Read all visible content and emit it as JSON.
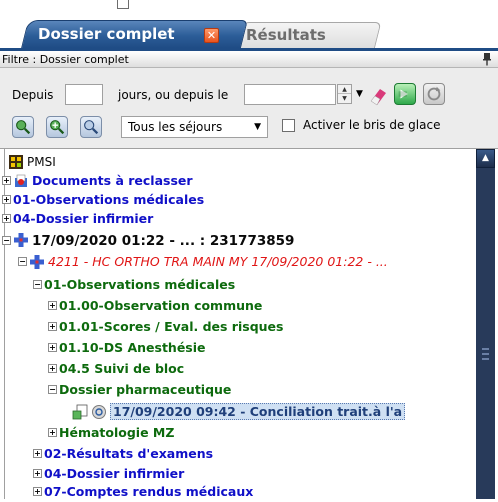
{
  "tabs": {
    "active": {
      "label": "Dossier complet"
    },
    "inactive": {
      "label": "Résultats"
    }
  },
  "filter": {
    "title": "Filtre : Dossier complet"
  },
  "toolbar": {
    "depuis_label": "Depuis",
    "jours_label": "jours, ou depuis le",
    "days_value": "",
    "date_value": "",
    "sejours_select": "Tous les séjours",
    "bris_label": "Activer le bris de glace"
  },
  "tree": {
    "pmsi": "PMSI",
    "documents": "Documents à reclasser",
    "obs_medicales_root": "01-Observations médicales",
    "dossier_infirmier_root": "04-Dossier infirmier",
    "sejour": "17/09/2020 01:22 - ... : 231773859",
    "uf": "4211 - HC ORTHO TRA MAIN MY 17/09/2020 01:22 - ...",
    "obs_medicales": "01-Observations médicales",
    "obs_commune": "01.00-Observation commune",
    "scores": "01.01-Scores / Eval. des risques",
    "ds_anesthesie": "01.10-DS Anesthésie",
    "suivi_bloc": "04.5 Suivi de bloc",
    "dossier_pharma": "Dossier pharmaceutique",
    "conciliation": "17/09/2020 09:42 - Conciliation trait.à l'a",
    "hematologie": "Hématologie MZ",
    "resultats_examens": "02-Résultats d'examens",
    "dossier_infirmier": "04-Dossier infirmier",
    "comptes_rendus": "07-Comptes rendus médicaux"
  },
  "colors": {
    "tab_active": "#2c5d98",
    "link_blue": "#1010c8",
    "folder_green": "#0d6a0d",
    "uf_red": "#e01515",
    "selection": "#cfe0f3"
  },
  "icons": [
    "close-icon",
    "pin-icon",
    "eraser-icon",
    "arrow-right-icon",
    "refresh-icon",
    "zoom-in-icon",
    "zoom-add-icon",
    "zoom-icon",
    "pmsi-icon",
    "documents-icon",
    "hospital-cross-icon",
    "document-share-icon",
    "info-icon"
  ]
}
